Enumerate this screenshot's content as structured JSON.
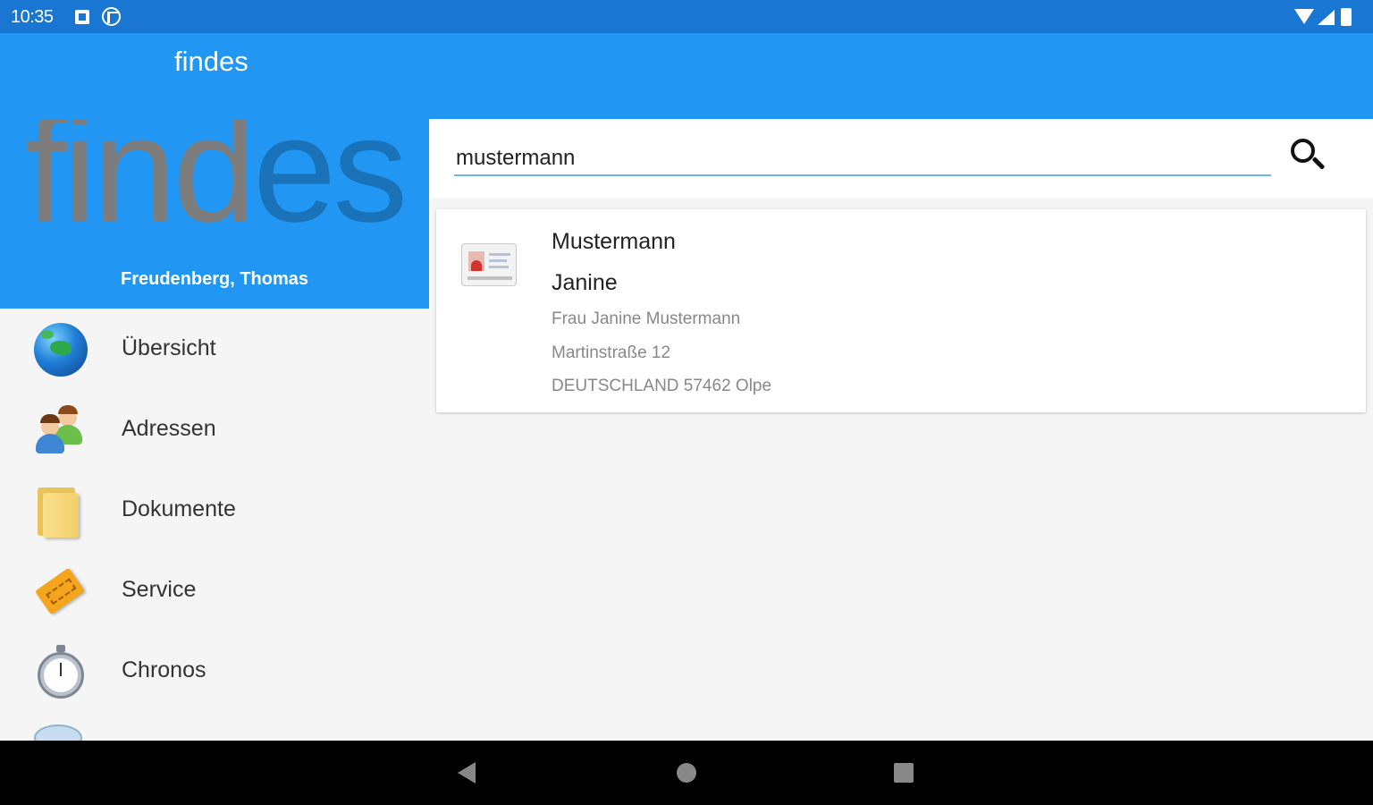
{
  "status_bar": {
    "time": "10:35"
  },
  "app_bar": {
    "title": "findes"
  },
  "drawer": {
    "logo": {
      "part_gray": "find",
      "part_blue": "es"
    },
    "user_name": "Freudenberg, Thomas",
    "menu": [
      {
        "label": "Übersicht",
        "icon": "globe-icon"
      },
      {
        "label": "Adressen",
        "icon": "contacts-icon"
      },
      {
        "label": "Dokumente",
        "icon": "folder-icon"
      },
      {
        "label": "Service",
        "icon": "ticket-icon"
      },
      {
        "label": "Chronos",
        "icon": "stopwatch-icon"
      }
    ]
  },
  "search": {
    "query": "mustermann"
  },
  "results": [
    {
      "last_name": "Mustermann",
      "first_name": "Janine",
      "full_name": "Frau Janine Mustermann",
      "street": "Martinstraße 12",
      "city_line": "DEUTSCHLAND 57462 Olpe",
      "icon": "contact-card-icon"
    }
  ],
  "colors": {
    "primary": "#2196f3",
    "primary_dark": "#1976d2",
    "logo_gray": "#7d7d7d",
    "logo_blue": "#1a73b8",
    "search_underline": "#6fb3f2"
  }
}
